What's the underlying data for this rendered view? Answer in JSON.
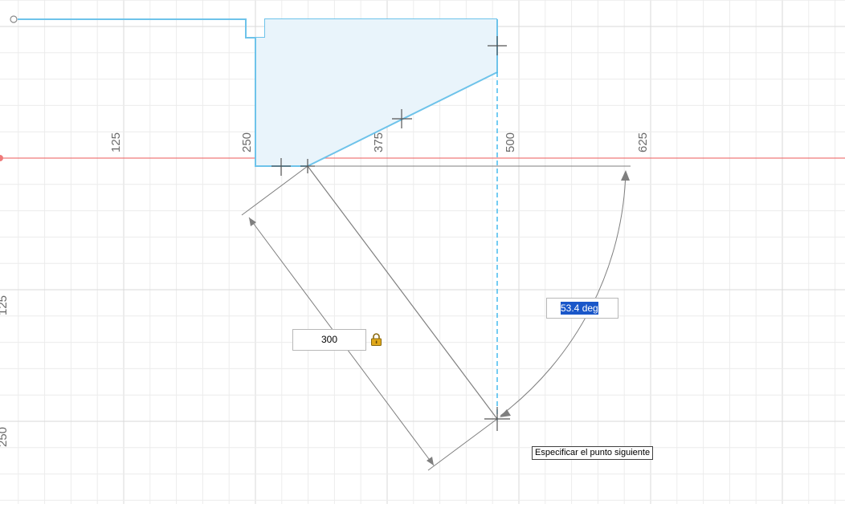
{
  "ruler": {
    "x_ticks": [
      "125",
      "250",
      "375",
      "500",
      "625"
    ],
    "y_ticks": [
      "125",
      "250"
    ]
  },
  "dimensions": {
    "length_value": "300",
    "angle_value": "53.4 deg"
  },
  "tooltip_text": "Especificar el punto siguiente",
  "colors": {
    "profile_stroke": "#6ec3ea",
    "profile_fill": "#e9f4fb",
    "x_axis": "#ef7a7a",
    "grid_minor": "#ececec",
    "grid_major": "#dadada",
    "dimension_line": "#7f7f7f",
    "construction_line": "#39b6ec",
    "selection": "#1a57c9",
    "lock": "#e0a81a"
  },
  "icons": {
    "lock": "lock-icon",
    "origin": "origin-point-icon"
  }
}
